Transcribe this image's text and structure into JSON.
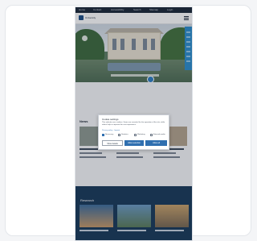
{
  "top_nav": {
    "links": [
      "Home",
      "Contact",
      "Accessibility",
      "Search",
      "Sitemap",
      "Login"
    ]
  },
  "header": {
    "brand": "University"
  },
  "news": {
    "title": "News"
  },
  "highlights": {
    "title": "Research"
  },
  "cookie_dialog": {
    "title": "Cookie settings",
    "text": "This website uses cookies. Some are essential for the operation of the site, while others help us improve the user experience.",
    "link": "Privacy policy · Imprint",
    "options": [
      {
        "label": "Necessary",
        "checked": true
      },
      {
        "label": "Statistics",
        "checked": false
      },
      {
        "label": "Marketing",
        "checked": false
      },
      {
        "label": "External media",
        "checked": false
      }
    ],
    "buttons": {
      "details": "Show details",
      "selection": "Allow selection",
      "all": "Allow all"
    }
  },
  "colors": {
    "accent": "#2f6fb0",
    "side_tab": "#2e8fcf",
    "dark_section": "#1a3b5c",
    "top_nav": "#1d2a3a"
  }
}
